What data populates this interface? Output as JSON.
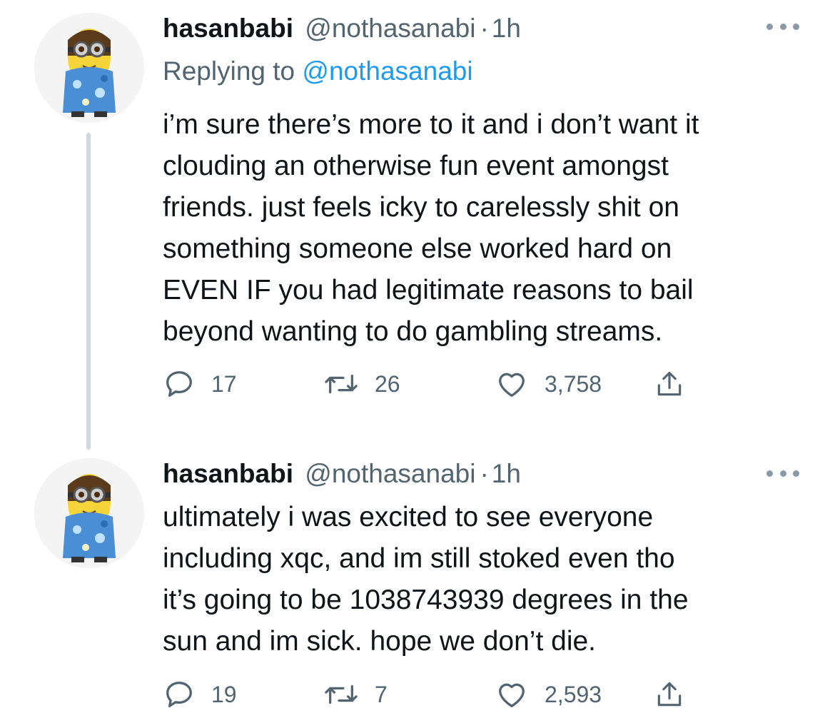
{
  "tweets": [
    {
      "display_name": "hasanbabi",
      "handle": "@nothasanabi",
      "separator": "·",
      "time": "1h",
      "reply_label": "Replying to",
      "reply_mention": "@nothasanabi",
      "lines": [
        "i’m sure there’s more to it and i don’t want it",
        "clouding an otherwise fun event amongst",
        "friends. just feels icky to carelessly shit on",
        "something someone else worked hard on",
        "EVEN IF you had legitimate reasons to bail",
        "beyond wanting to do gambling streams."
      ],
      "replies": "17",
      "retweets": "26",
      "likes": "3,758"
    },
    {
      "display_name": "hasanbabi",
      "handle": "@nothasanabi",
      "separator": "·",
      "time": "1h",
      "lines": [
        "ultimately i was excited to see everyone",
        "including xqc, and im still stoked even tho",
        "it’s going to be 1038743939 degrees in the",
        "sun and im sick. hope we don’t die."
      ],
      "replies": "19",
      "retweets": "7",
      "likes": "2,593"
    }
  ],
  "icons": {
    "reply": "reply-icon",
    "retweet": "retweet-icon",
    "like": "heart-icon",
    "share": "share-icon",
    "more": "more-options-icon"
  },
  "colors": {
    "text": "#0f1419",
    "secondary": "#536471",
    "link": "#1d9bf0",
    "thread_line": "#cfd9de",
    "avatar_body": "#f5d53a",
    "avatar_shirt": "#4a8fd6"
  }
}
